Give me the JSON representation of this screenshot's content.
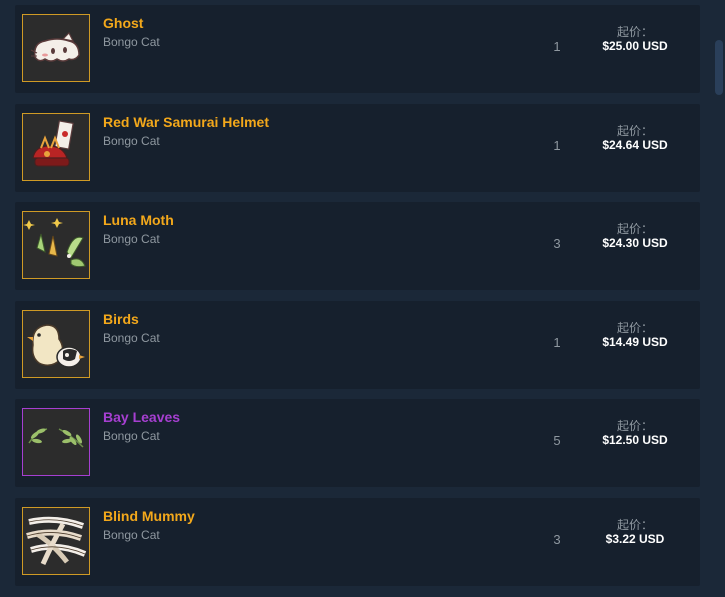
{
  "listings": [
    {
      "name": "Ghost",
      "game": "Bongo Cat",
      "quantity": "1",
      "price_label": "起价：",
      "price": "$25.00 USD",
      "name_color": "#f3a81b",
      "border_color": "#cf9a25",
      "icon": "ghost-cat-icon"
    },
    {
      "name": "Red War Samurai Helmet",
      "game": "Bongo Cat",
      "quantity": "1",
      "price_label": "起价：",
      "price": "$24.64 USD",
      "name_color": "#f3a81b",
      "border_color": "#cf9a25",
      "icon": "samurai-helmet-icon"
    },
    {
      "name": "Luna Moth",
      "game": "Bongo Cat",
      "quantity": "3",
      "price_label": "起价：",
      "price": "$24.30 USD",
      "name_color": "#f3a81b",
      "border_color": "#cf9a25",
      "icon": "luna-moth-icon"
    },
    {
      "name": "Birds",
      "game": "Bongo Cat",
      "quantity": "1",
      "price_label": "起价：",
      "price": "$14.49 USD",
      "name_color": "#f3a81b",
      "border_color": "#cf9a25",
      "icon": "birds-icon"
    },
    {
      "name": "Bay Leaves",
      "game": "Bongo Cat",
      "quantity": "5",
      "price_label": "起价：",
      "price": "$12.50 USD",
      "name_color": "#a63fd1",
      "border_color": "#a63fd1",
      "icon": "bay-leaves-icon"
    },
    {
      "name": "Blind Mummy",
      "game": "Bongo Cat",
      "quantity": "3",
      "price_label": "起价：",
      "price": "$3.22 USD",
      "name_color": "#f3a81b",
      "border_color": "#cf9a25",
      "icon": "mummy-wrap-icon"
    }
  ]
}
